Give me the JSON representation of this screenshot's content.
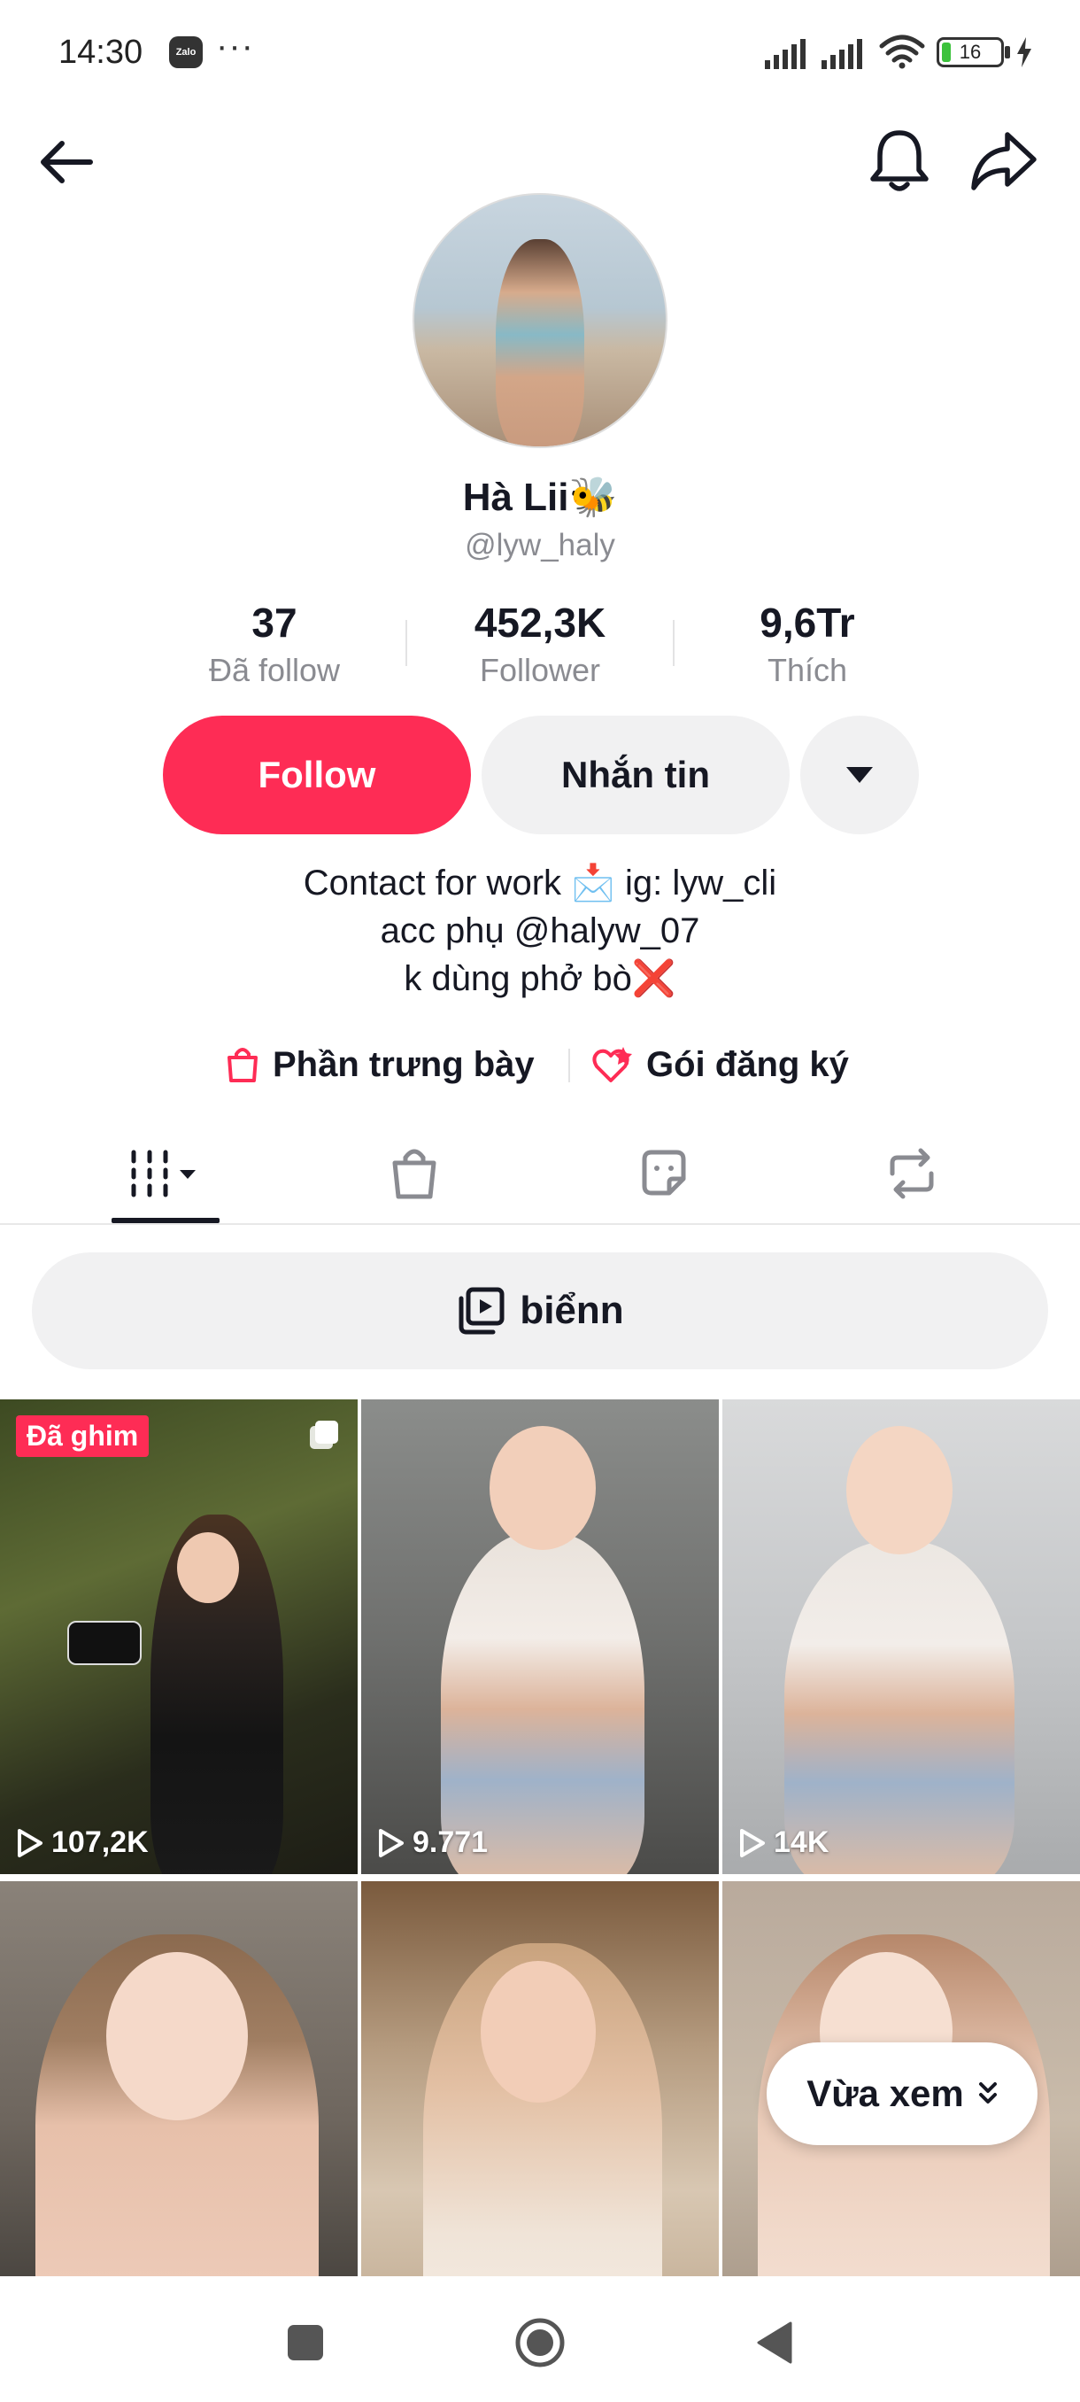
{
  "status_bar": {
    "time": "14:30",
    "zalo_label": "Zalo",
    "more": "···",
    "battery": "16",
    "battery_level": 0.16
  },
  "header": {
    "back_icon": "arrow-left-icon",
    "bell_icon": "bell-icon",
    "share_icon": "share-arrow-icon"
  },
  "profile": {
    "name": "Hà Lii🐝",
    "username": "@lyw_haly",
    "stats": [
      {
        "value": "37",
        "label": "Đã follow"
      },
      {
        "value": "452,3K",
        "label": "Follower"
      },
      {
        "value": "9,6Tr",
        "label": "Thích"
      }
    ],
    "follow_label": "Follow",
    "message_label": "Nhắn tin",
    "bio_lines": [
      "Contact for work 📩 ig: lyw_cli",
      "acc phụ @halyw_07",
      "k dùng phở bò❌"
    ],
    "links": [
      {
        "label": "Phần trưng bày",
        "icon": "shopping-bag-icon"
      },
      {
        "label": "Gói đăng ký",
        "icon": "subscription-heart-icon"
      }
    ]
  },
  "colors": {
    "accent": "#fe2c55",
    "text": "#161823",
    "muted": "#8a8b91",
    "pill_bg": "#f1f1f2"
  },
  "tabs": [
    {
      "name": "videos",
      "icon": "grid-icon",
      "active": true
    },
    {
      "name": "shop",
      "icon": "shopping-bag-icon"
    },
    {
      "name": "stickers",
      "icon": "sticker-icon"
    },
    {
      "name": "reposts",
      "icon": "repost-icon"
    }
  ],
  "playlist": {
    "label": "biểnn",
    "icon": "playlist-icon"
  },
  "videos": [
    {
      "views": "107,2K",
      "pinned_label": "Đã ghim",
      "multi": true
    },
    {
      "views": "9.771"
    },
    {
      "views": "14K"
    },
    {
      "views": ""
    },
    {
      "views": ""
    },
    {
      "views": ""
    }
  ],
  "recent_pill": {
    "label": "Vừa xem",
    "icon": "chevron-double-down-icon"
  },
  "nav": [
    "recents-square-icon",
    "home-circle-icon",
    "back-triangle-icon"
  ]
}
